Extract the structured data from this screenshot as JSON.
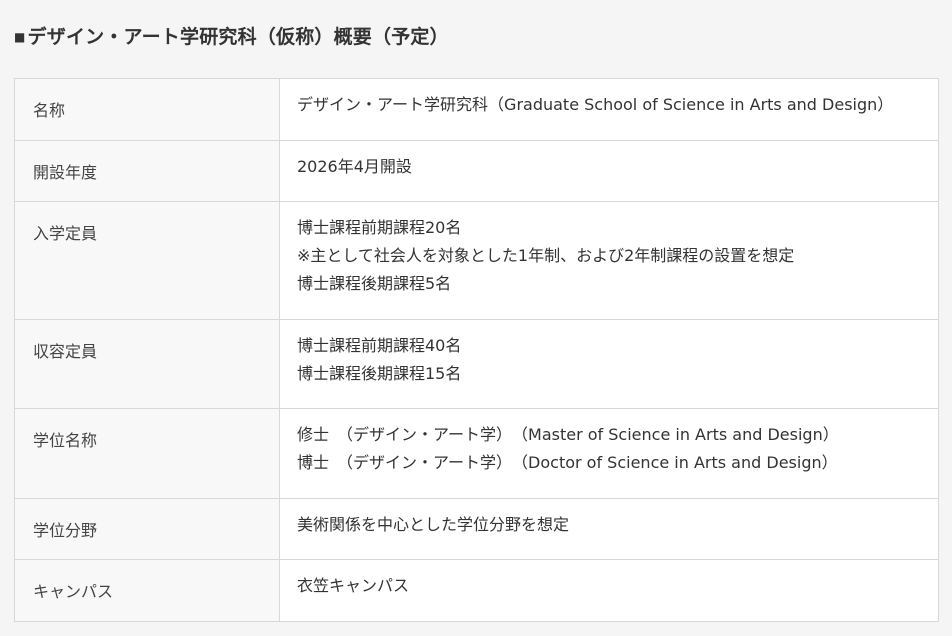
{
  "heading": {
    "marker": "■",
    "title": "デザイン・アート学研究科（仮称）概要（予定）"
  },
  "rows": [
    {
      "label": "名称",
      "lines": [
        "デザイン・アート学研究科（Graduate School of Science in Arts and Design）"
      ]
    },
    {
      "label": "開設年度",
      "lines": [
        "2026年4月開設"
      ]
    },
    {
      "label": "入学定員",
      "lines": [
        "博士課程前期課程20名",
        "※主として社会人を対象とした1年制、および2年制課程の設置を想定",
        "博士課程後期課程5名"
      ]
    },
    {
      "label": "収容定員",
      "lines": [
        "博士課程前期課程40名",
        "博士課程後期課程15名"
      ]
    },
    {
      "label": "学位名称",
      "lines": [
        "修士　（デザイン・アート学）　（Master of Science in Arts and Design）",
        "博士　（デザイン・アート学）　（Doctor of Science in Arts and Design）"
      ]
    },
    {
      "label": "学位分野",
      "lines": [
        "美術関係を中心とした学位分野を想定"
      ]
    },
    {
      "label": "キャンパス",
      "lines": [
        "衣笠キャンパス"
      ]
    }
  ]
}
